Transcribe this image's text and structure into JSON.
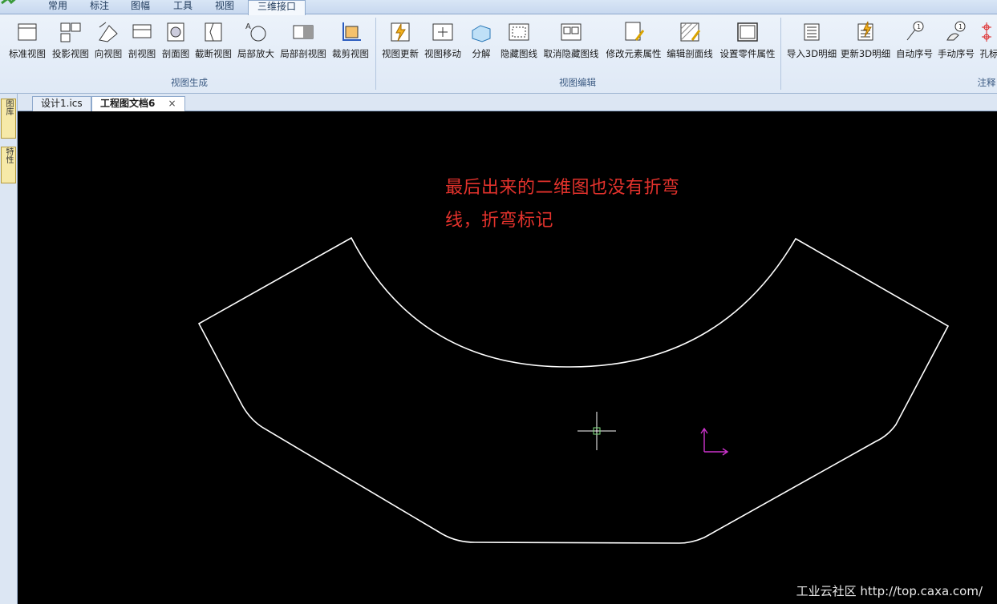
{
  "ribbon": {
    "tabs": [
      "常用",
      "标注",
      "图幅",
      "工具",
      "视图",
      "三维接口"
    ],
    "active_tab": "三维接口",
    "groups": [
      {
        "title": "视图生成",
        "buttons": [
          "标准视图",
          "投影视图",
          "向视图",
          "剖视图",
          "剖面图",
          "截断视图",
          "局部放大",
          "局部剖视图",
          "裁剪视图"
        ]
      },
      {
        "title": "视图编辑",
        "buttons": [
          "视图更新",
          "视图移动",
          "分解",
          "隐藏图线",
          "取消隐藏图线",
          "修改元素属性",
          "编辑剖面线",
          "设置零件属性"
        ]
      },
      {
        "title": "注释",
        "buttons": [
          "导入3D明细",
          "更新3D明细",
          "自动序号",
          "手动序号",
          "孔标"
        ]
      }
    ]
  },
  "side_tabs": [
    "图库",
    "特性"
  ],
  "doc_tabs": [
    {
      "label": "设计1.ics",
      "active": false
    },
    {
      "label": "工程图文档6",
      "active": true,
      "close": "×"
    }
  ],
  "canvas": {
    "background": "#000000",
    "annotation_line1": "最后出来的二维图也没有折弯",
    "annotation_line2": "线，折弯标记",
    "annotation_color": "#e3322c",
    "shape_color": "#ffffff",
    "axis_color": "#cc33cc",
    "cursor_color": "#ffffff"
  },
  "watermark": "工业云社区 http://top.caxa.com/"
}
